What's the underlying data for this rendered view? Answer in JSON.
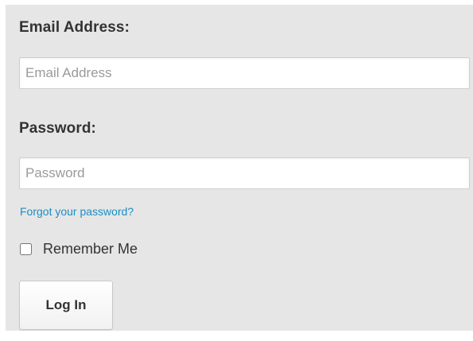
{
  "form": {
    "email": {
      "label": "Email Address:",
      "value": "",
      "placeholder": "Email Address"
    },
    "password": {
      "label": "Password:",
      "value": "",
      "placeholder": "Password"
    },
    "forgot_link": "Forgot your password?",
    "remember": {
      "label": "Remember Me",
      "checked": false
    },
    "submit_label": "Log In"
  },
  "colors": {
    "panel_background": "#e6e6e6",
    "link": "#1a8fc6",
    "label_text": "#333333",
    "placeholder_text": "#9a9a9a"
  }
}
